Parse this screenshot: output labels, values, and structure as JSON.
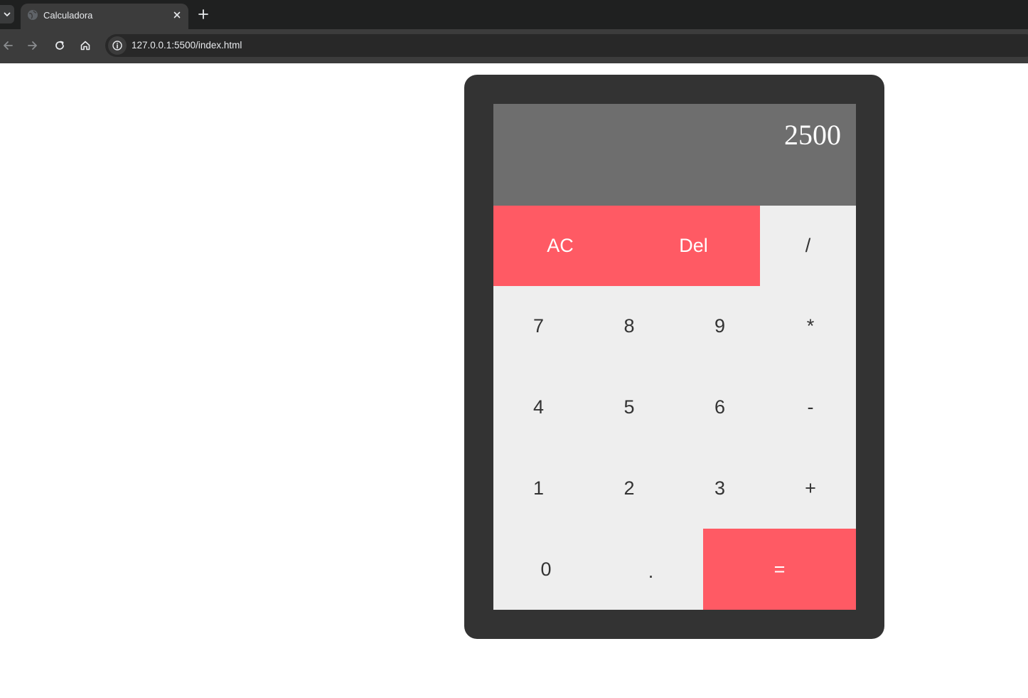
{
  "browser": {
    "tab_title": "Calculadora",
    "url": "127.0.0.1:5500/index.html"
  },
  "colors": {
    "accent": "#ff5a64",
    "display_bg": "#6e6e6e",
    "body_bg": "#333333",
    "key_bg": "#eeeeee"
  },
  "calculator": {
    "display": "2500",
    "keys": {
      "ac": "AC",
      "del": "Del",
      "divide": "/",
      "seven": "7",
      "eight": "8",
      "nine": "9",
      "multiply": "*",
      "four": "4",
      "five": "5",
      "six": "6",
      "minus": "-",
      "one": "1",
      "two": "2",
      "three": "3",
      "plus": "+",
      "zero": "0",
      "dot": ".",
      "equals": "="
    }
  }
}
